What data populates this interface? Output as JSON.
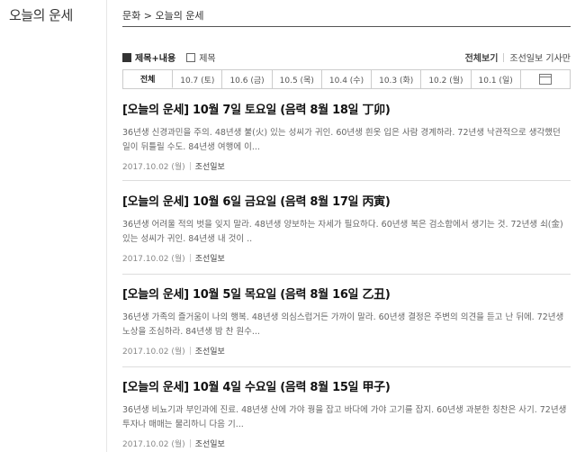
{
  "section_title": "오늘의 운세",
  "breadcrumb": "문화 > 오늘의 운세",
  "options": {
    "title_content": "제목+내용",
    "title_only": "제목"
  },
  "right_links": {
    "view_all": "전체보기",
    "reporter": "조선일보 기사만"
  },
  "tabs": [
    "전체",
    "10.7 (토)",
    "10.6 (금)",
    "10.5 (목)",
    "10.4 (수)",
    "10.3 (화)",
    "10.2 (월)",
    "10.1 (일)"
  ],
  "articles": [
    {
      "title": "[오늘의 운세] 10월 7일 토요일 (음력 8월 18일 丁卯)",
      "summary": "36년생 신경과민을 주의. 48년생 불(火) 있는 성씨가 귀인. 60년생 흰옷 입은 사람 경계하라. 72년생 낙관적으로 생각했던 일이 뒤틀릴 수도. 84년생 여행에 이...",
      "date": "2017.10.02 (월)",
      "source": "조선일보"
    },
    {
      "title": "[오늘의 운세] 10월 6일 금요일 (음력 8월 17일 丙寅)",
      "summary": "36년생 어려울 적의 벗을 잊지 말라. 48년생 양보하는 자세가 필요하다. 60년생 복은 검소함에서 생기는 것. 72년생 쇠(金) 있는 성씨가 귀인. 84년생 내 것이 ..",
      "date": "2017.10.02 (월)",
      "source": "조선일보"
    },
    {
      "title": "[오늘의 운세] 10월 5일 목요일 (음력 8월 16일 乙丑)",
      "summary": "36년생 가족의 즐거움이 나의 행복. 48년생 의심스럽거든 가까이 말라. 60년생 결정은 주변의 의견을 듣고 난 뒤에. 72년생 노상을 조심하라. 84년생 밤 찬 원수...",
      "date": "2017.10.02 (월)",
      "source": "조선일보"
    },
    {
      "title": "[오늘의 운세] 10월 4일 수요일 (음력 8월 15일 甲子)",
      "summary": "36년생 비뇨기과 부인과에 진료. 48년생 산에 가야 꿩을 잡고 바다에 가야 고기를 잡지. 60년생 과분한 칭찬은 사기. 72년생 투자나 매매는 물리하니 다음 기...",
      "date": "2017.10.02 (월)",
      "source": "조선일보"
    }
  ]
}
